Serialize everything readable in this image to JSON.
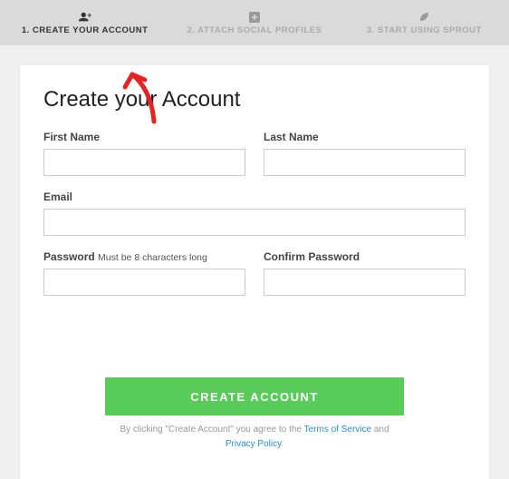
{
  "stepper": {
    "step1": "1. CREATE YOUR ACCOUNT",
    "step2": "2. ATTACH SOCIAL PROFILES",
    "step3": "3. START USING SPROUT"
  },
  "form": {
    "heading": "Create your Account",
    "first_name_label": "First Name",
    "last_name_label": "Last Name",
    "email_label": "Email",
    "password_label": "Password",
    "password_hint": "Must be 8 characters long",
    "confirm_password_label": "Confirm Password",
    "submit_label": "CREATE ACCOUNT",
    "legal_prefix": "By clicking \"Create Account\" you agree to the ",
    "tos": "Terms of Service",
    "legal_and": " and ",
    "privacy": "Privacy Policy",
    "legal_suffix": "."
  }
}
